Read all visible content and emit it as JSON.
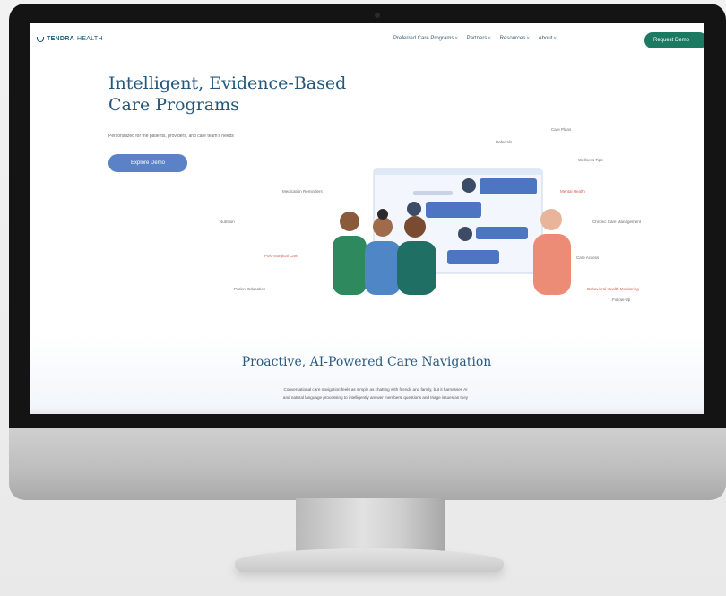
{
  "nav": {
    "logo_strong": "TENDRA",
    "logo_light": "HEALTH",
    "menu": [
      "Preferred Care Programs",
      "Partners",
      "Resources",
      "About"
    ],
    "cta": "Request Demo"
  },
  "hero": {
    "title_line1": "Intelligent, Evidence-Based",
    "title_line2": "Care Programs",
    "subtitle": "Personalized for the patients, providers, and care team's needs",
    "button": "Explore Demo"
  },
  "tags": {
    "t1": "Care Plans",
    "t2": "Referrals",
    "t3": "Wellness Tips",
    "t4": "Medication Reminders",
    "t5": "Mental Health",
    "t6": "Nutrition",
    "t7": "Chronic Care Management",
    "t8": "Post-Surgical Care",
    "t9": "Care Access",
    "t10": "Patient Education",
    "t11": "Behavioral Health Monitoring",
    "t12": "Follow-Up"
  },
  "section": {
    "title": "Proactive, AI-Powered Care Navigation",
    "body_line1": "Conversational care navigation feels as simple as chatting with friends and family, but it harnesses AI",
    "body_line2": "and natural language processing to intelligently answer members' questions and triage issues as they"
  },
  "colors": {
    "brand": "#25577a",
    "cta_green": "#1c7a63",
    "button_blue": "#5b82c7",
    "tag_red": "#d05a4b"
  }
}
